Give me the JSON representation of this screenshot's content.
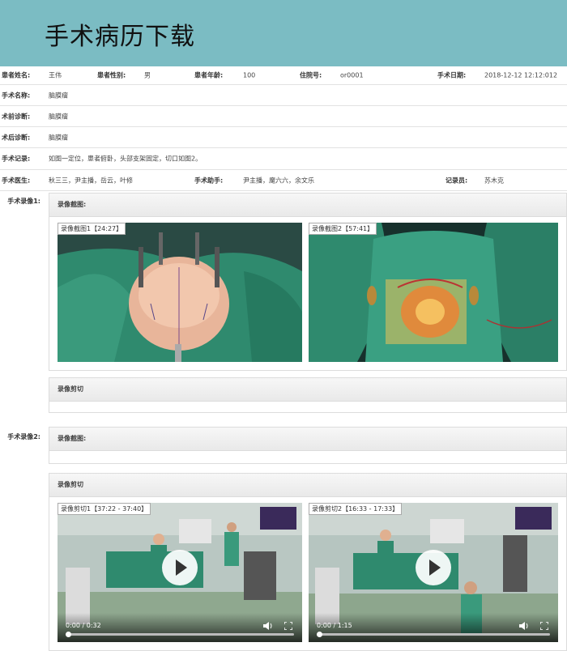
{
  "header": {
    "title": "手术病历下载"
  },
  "patient": {
    "name_label": "患者姓名:",
    "name": "王伟",
    "gender_label": "患者性别:",
    "gender": "男",
    "age_label": "患者年龄:",
    "age": "100",
    "admission_label": "住院号:",
    "admission": "or0001",
    "date_label": "手术日期:",
    "date": "2018-12-12 12:12:012"
  },
  "surgery": {
    "name_label": "手术名称:",
    "name": "脑膜瘤",
    "pre_label": "术前诊断:",
    "pre": "脑膜瘤",
    "post_label": "术后诊断:",
    "post": "脑膜瘤",
    "record_label": "手术记录:",
    "record": "如图一定位，患者俯卧，头部支架固定，切口如图2。",
    "doctor_label": "手术医生:",
    "doctors": "秋三三，尹主播，岳云，叶修",
    "assistant_label": "手术助手:",
    "assistants": "尹主播，魔六六，余文乐",
    "recorder_label": "记录员:",
    "recorder": "苏木克"
  },
  "recordings": [
    {
      "label": "手术录像1:",
      "screenshots_title": "录像截图:",
      "screenshots": [
        {
          "caption": "录像截图1【24:27】"
        },
        {
          "caption": "录像截图2【57:41】"
        }
      ],
      "clips_title": "录像剪切"
    },
    {
      "label": "手术录像2:",
      "screenshots_title": "录像截图:",
      "clips_title": "录像剪切",
      "clips": [
        {
          "caption": "录像剪切1【37:22 - 37:40】",
          "time": "0:00 / 0:32"
        },
        {
          "caption": "录像剪切2【16:33 - 17:33】",
          "time": "0:00 / 1:15"
        }
      ]
    }
  ],
  "colors": {
    "header": "#7bbcc3",
    "surgical_green": "#2f8a6e",
    "panel_head": "#ececec"
  }
}
